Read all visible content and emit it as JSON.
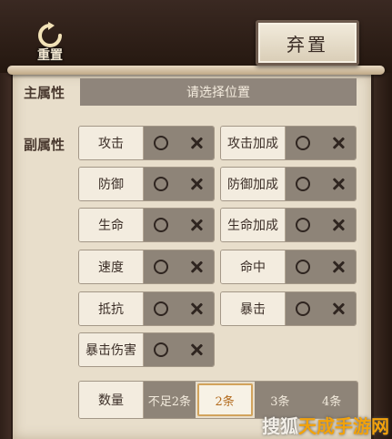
{
  "header": {
    "reset_label": "重置",
    "discard_label": "弃置"
  },
  "main_attr": {
    "label": "主属性",
    "placeholder": "请选择位置"
  },
  "sub_attr": {
    "label": "副属性",
    "left": [
      "攻击",
      "防御",
      "生命",
      "速度",
      "抵抗",
      "暴击伤害"
    ],
    "right": [
      "攻击加成",
      "防御加成",
      "生命加成",
      "命中",
      "暴击"
    ]
  },
  "count": {
    "label": "数量",
    "options": [
      "不足2条",
      "2条",
      "3条",
      "4条"
    ],
    "selected": "2条"
  },
  "watermark": {
    "prefix": "搜狐",
    "brand": "天成手游网"
  }
}
